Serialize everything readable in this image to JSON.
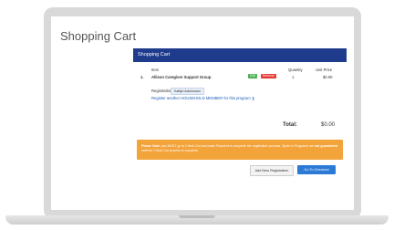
{
  "page": {
    "title": "Shopping Cart"
  },
  "cart": {
    "header": "Shopping Cart",
    "columns": {
      "item": "Item",
      "quantity": "Quantity",
      "unit_price": "Unit Price"
    },
    "items": [
      {
        "number": "1.",
        "name": "Allison Caregiver Support Group",
        "badges": [
          "Edit",
          "Remove"
        ],
        "quantity": "1",
        "unit_price": "$0.00"
      }
    ],
    "registration_label": "Registration:",
    "registrant_chip": "Kaitlyn Ackermann",
    "register_another_link": "Register another HOUSEHOLD MEMBER for this program ❯",
    "total_label": "Total:",
    "total_value": "$0.00"
  },
  "notice": {
    "prefix": "Please Note:",
    "text_1": " you MUST go to Check Out and make Payment to complete the registration process. Spots in Programs are ",
    "emphasis": "not guaranteed",
    "text_2": " until the Check Out process is complete."
  },
  "actions": {
    "add_registration": "Add New Registration",
    "checkout": "Go To Checkout"
  },
  "colors": {
    "header_bg": "#1f3b8c",
    "notice_bg": "#f2a33a",
    "checkout_bg": "#2b7bd6",
    "badge_green": "#4caf50",
    "badge_red": "#e53935"
  }
}
